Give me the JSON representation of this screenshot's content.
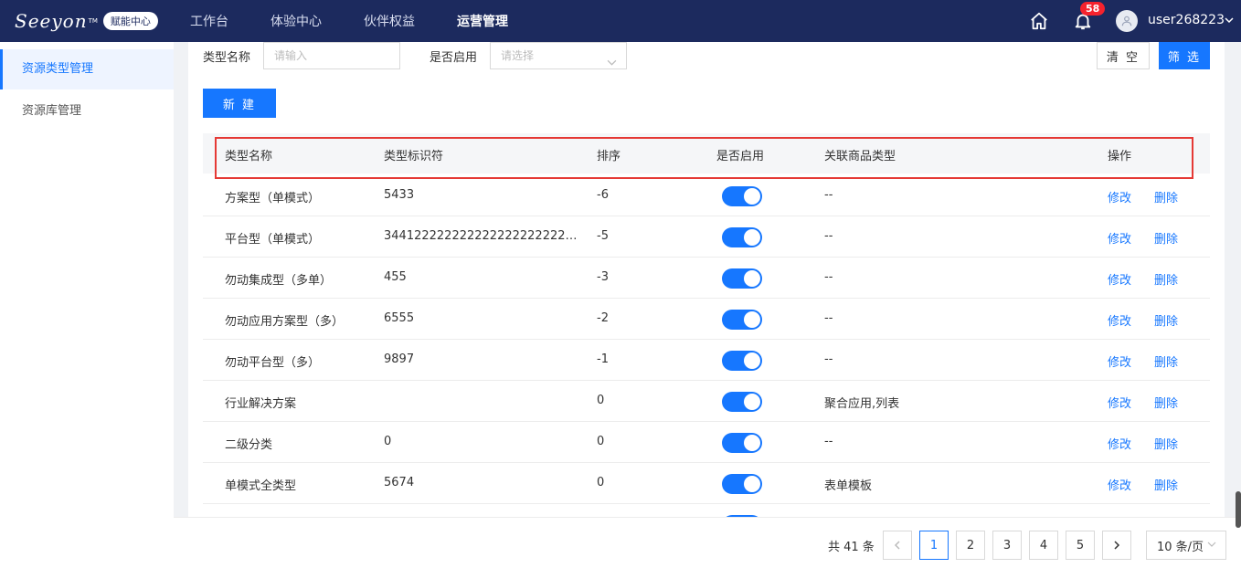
{
  "brand": {
    "logo": "Seeyon",
    "tm": "TM",
    "badge": "赋能中心"
  },
  "nav": [
    {
      "label": "工作台",
      "active": false
    },
    {
      "label": "体验中心",
      "active": false
    },
    {
      "label": "伙伴权益",
      "active": false
    },
    {
      "label": "运营管理",
      "active": true
    }
  ],
  "header": {
    "notifications": "58",
    "username": "user268223"
  },
  "sidebar": {
    "items": [
      {
        "label": "资源类型管理",
        "active": true
      },
      {
        "label": "资源库管理",
        "active": false
      }
    ]
  },
  "filter": {
    "type_name_label": "类型名称",
    "type_name_placeholder": "请输入",
    "enabled_label": "是否启用",
    "enabled_placeholder": "请选择",
    "clear_label": "清 空",
    "filter_label": "筛 选",
    "new_label": "新 建"
  },
  "table": {
    "columns": [
      "类型名称",
      "类型标识符",
      "排序",
      "是否启用",
      "关联商品类型",
      "操作"
    ],
    "edit_label": "修改",
    "delete_label": "删除",
    "rows": [
      {
        "name": "方案型（单模式）",
        "identifier": "5433",
        "sort": "-6",
        "enabled": true,
        "related": "--"
      },
      {
        "name": "平台型（单模式）",
        "identifier": "344122222222222222222222222...",
        "sort": "-5",
        "enabled": true,
        "related": "--"
      },
      {
        "name": "勿动集成型（多单）",
        "identifier": "455",
        "sort": "-3",
        "enabled": true,
        "related": "--"
      },
      {
        "name": "勿动应用方案型（多）",
        "identifier": "6555",
        "sort": "-2",
        "enabled": true,
        "related": "--"
      },
      {
        "name": "勿动平台型（多）",
        "identifier": "9897",
        "sort": "-1",
        "enabled": true,
        "related": "--"
      },
      {
        "name": "行业解决方案",
        "identifier": "",
        "sort": "0",
        "enabled": true,
        "related": "聚合应用,列表"
      },
      {
        "name": "二级分类",
        "identifier": "0",
        "sort": "0",
        "enabled": true,
        "related": "--"
      },
      {
        "name": "单模式全类型",
        "identifier": "5674",
        "sort": "0",
        "enabled": true,
        "related": "表单模板"
      }
    ]
  },
  "pagination": {
    "total": "共 41 条",
    "pages": [
      "1",
      "2",
      "3",
      "4",
      "5"
    ],
    "current": "1",
    "page_size": "10 条/页"
  },
  "colors": {
    "nav_bg": "#1c2a5e",
    "primary": "#1677ff",
    "highlight": "#e53935",
    "badge": "#f5222d"
  }
}
